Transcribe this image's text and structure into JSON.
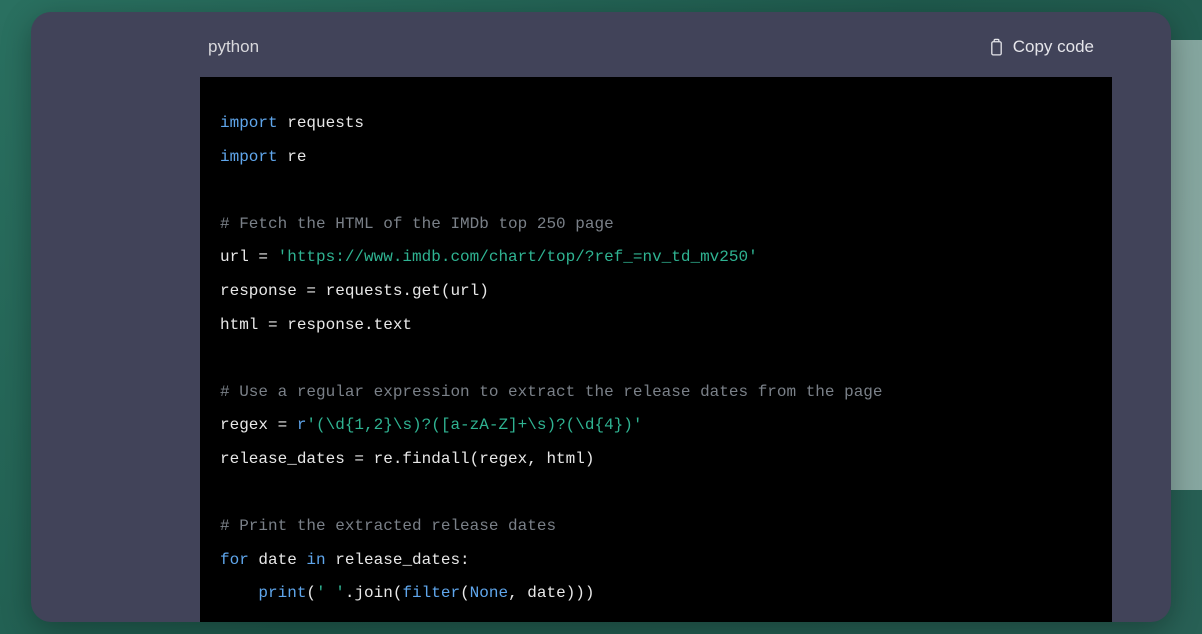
{
  "header": {
    "language_label": "python",
    "copy_label": "Copy code"
  },
  "code": {
    "l1_kw1": "import",
    "l1_mod": " requests",
    "l2_kw1": "import",
    "l2_mod": " re",
    "l3_blank": "",
    "l4_comment": "# Fetch the HTML of the IMDb top 250 page",
    "l5_a": "url = ",
    "l5_str": "'https://www.imdb.com/chart/top/?ref_=nv_td_mv250'",
    "l6": "response = requests.get(url)",
    "l7": "html = response.text",
    "l8_blank": "",
    "l9_comment": "# Use a regular expression to extract the release dates from the page",
    "l10_a": "regex = ",
    "l10_r": "r",
    "l10_str": "'(\\d{1,2}\\s)?([a-zA-Z]+\\s)?(\\d{4})'",
    "l11": "release_dates = re.findall(regex, html)",
    "l12_blank": "",
    "l13_comment": "# Print the extracted release dates",
    "l14_kw1": "for",
    "l14_a": " date ",
    "l14_kw2": "in",
    "l14_b": " release_dates:",
    "l15_indent": "    ",
    "l15_print": "print",
    "l15_a": "(",
    "l15_str": "' '",
    "l15_b": ".join(",
    "l15_filter": "filter",
    "l15_c": "(",
    "l15_none": "None",
    "l15_d": ", date)))"
  }
}
